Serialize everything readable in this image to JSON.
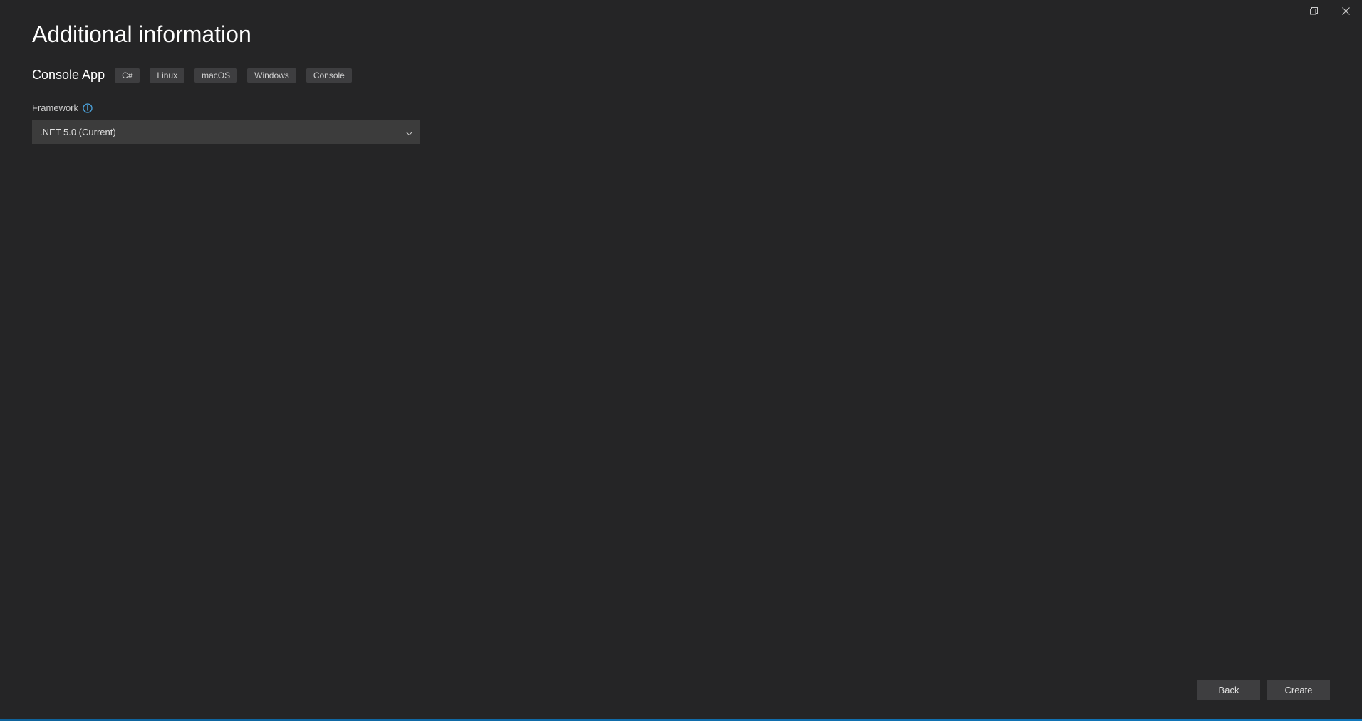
{
  "titlebar": {
    "maximize_label": "Maximize",
    "close_label": "Close"
  },
  "page": {
    "title": "Additional information"
  },
  "template": {
    "name": "Console App",
    "tags": [
      "C#",
      "Linux",
      "macOS",
      "Windows",
      "Console"
    ]
  },
  "framework": {
    "label": "Framework",
    "info_tooltip": "Info",
    "selected": ".NET 5.0 (Current)"
  },
  "footer": {
    "back_label": "Back",
    "create_label": "Create"
  }
}
